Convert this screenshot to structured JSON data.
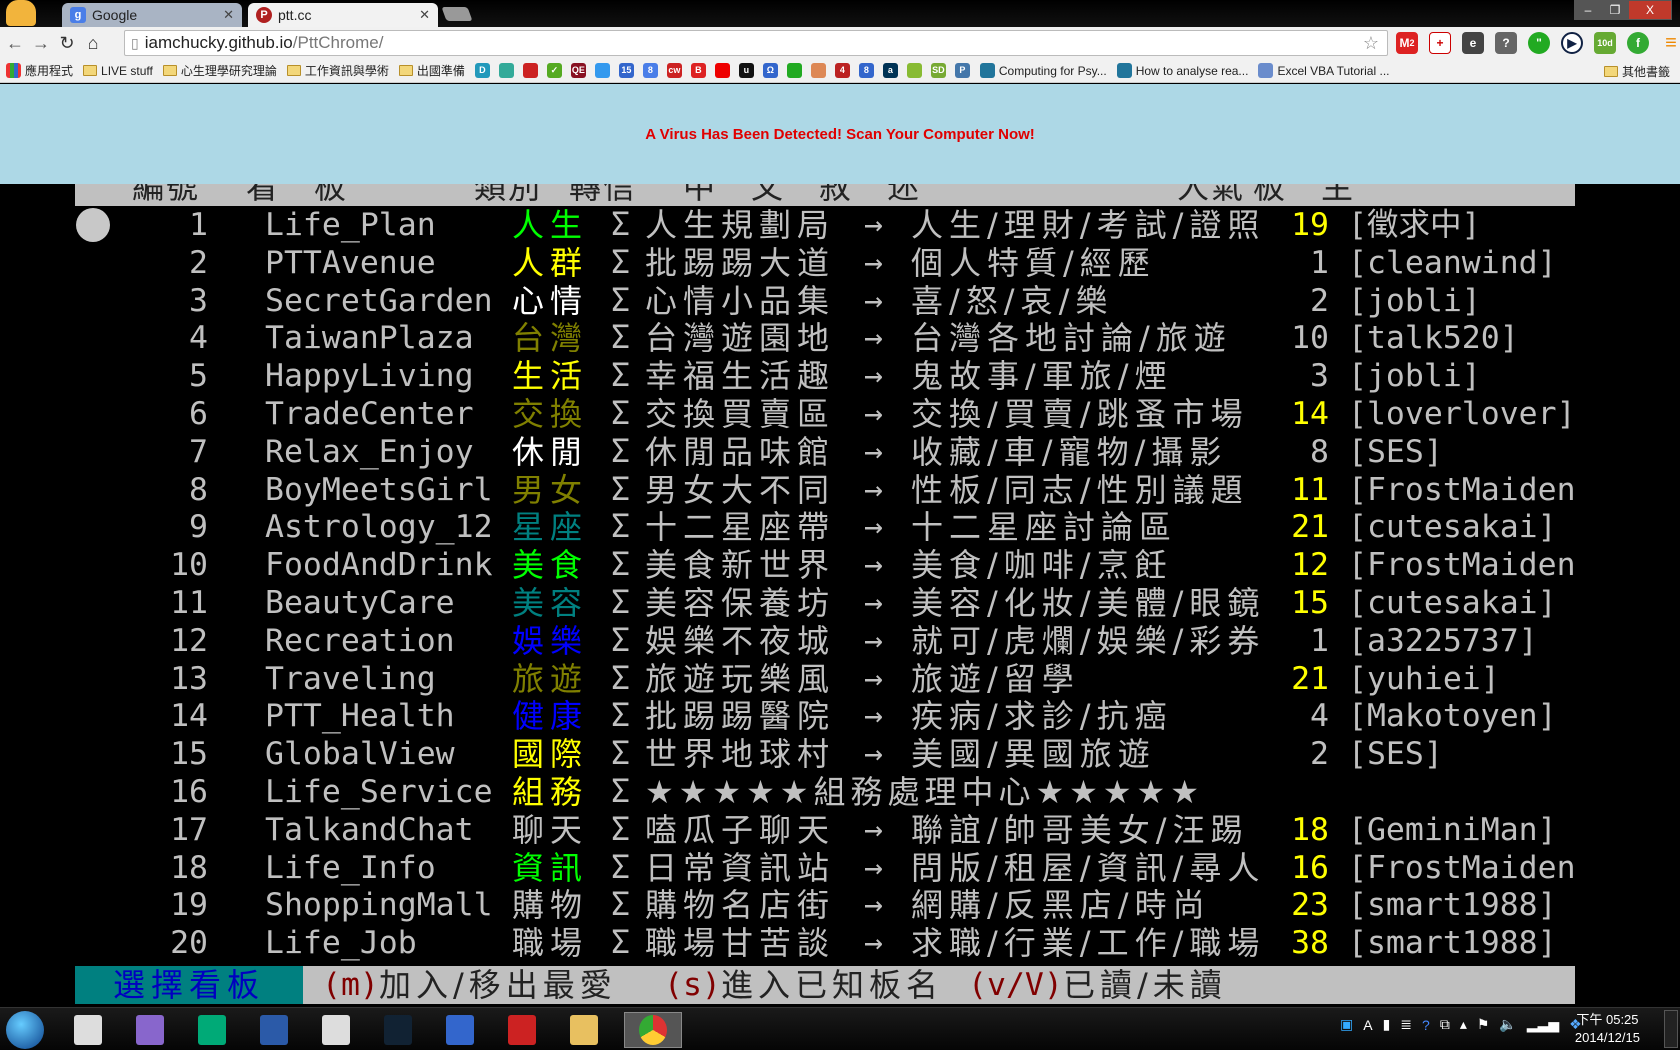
{
  "browser": {
    "tabs": [
      {
        "label": "Google",
        "icon": "google-icon"
      },
      {
        "label": "ptt.cc",
        "icon": "ptt-icon"
      }
    ],
    "url_host": "iamchucky.github.io",
    "url_path": "/PttChrome/",
    "window_controls": {
      "minimize": "–",
      "restore": "❐",
      "close": "X"
    },
    "extension_badges": {
      "gmail": "2",
      "timer": "10d"
    },
    "bookmarks": [
      {
        "label": "應用程式",
        "type": "apps"
      },
      {
        "label": "LIVE stuff",
        "type": "folder"
      },
      {
        "label": "心生理學研究理論",
        "type": "folder"
      },
      {
        "label": "工作資訊與學術",
        "type": "folder"
      },
      {
        "label": "出國準備",
        "type": "folder"
      }
    ],
    "bookmark_icon_labels": [
      "D",
      "",
      "",
      "✓",
      "QE",
      "",
      "15",
      "8",
      "cw",
      "B",
      "",
      "u",
      "Ω",
      "",
      "",
      "4",
      "8",
      "a",
      "",
      "SD",
      "P"
    ],
    "bookmark_links": [
      "Computing for Psy...",
      "How to analyse rea...",
      "Excel VBA Tutorial ..."
    ],
    "other_bookmarks": "其他書籤"
  },
  "ad": {
    "text": "A Virus Has Been Detected! Scan Your Computer Now!"
  },
  "terminal": {
    "header": [
      "編號",
      "看　板",
      "類別",
      "轉信",
      "中　文　敘　述",
      "人氣",
      "板　主"
    ],
    "colors": {
      "green": "#00ff00",
      "yellow": "#ffff00",
      "white": "#ffffff",
      "olive": "#808000",
      "teal": "#008080",
      "blue": "#0000ff",
      "gray": "#c0c0c0"
    },
    "sigma": "Σ",
    "arrow": "→",
    "rows": [
      {
        "num": "1",
        "board": "Life_Plan",
        "cat": "人生",
        "cat_color": "#00ff00",
        "title": "人生規劃局",
        "desc": "人生/理財/考試/證照",
        "pop": "19",
        "pop_color": "#ffff00",
        "mod": "[徵求中]"
      },
      {
        "num": "2",
        "board": "PTTAvenue",
        "cat": "人群",
        "cat_color": "#ffff00",
        "title": "批踢踢大道",
        "desc": "個人特質/經歷",
        "pop": "1",
        "pop_color": "#c0c0c0",
        "mod": "[cleanwind]"
      },
      {
        "num": "3",
        "board": "SecretGarden",
        "cat": "心情",
        "cat_color": "#ffffff",
        "title": "心情小品集",
        "desc": "喜/怒/哀/樂",
        "pop": "2",
        "pop_color": "#c0c0c0",
        "mod": "[jobli]"
      },
      {
        "num": "4",
        "board": "TaiwanPlaza",
        "cat": "台灣",
        "cat_color": "#808000",
        "title": "台灣遊園地",
        "desc": "台灣各地討論/旅遊",
        "pop": "10",
        "pop_color": "#c0c0c0",
        "mod": "[talk520]"
      },
      {
        "num": "5",
        "board": "HappyLiving",
        "cat": "生活",
        "cat_color": "#ffff00",
        "title": "幸福生活趣",
        "desc": "鬼故事/軍旅/煙",
        "pop": "3",
        "pop_color": "#c0c0c0",
        "mod": "[jobli]"
      },
      {
        "num": "6",
        "board": "TradeCenter",
        "cat": "交換",
        "cat_color": "#808000",
        "title": "交換買賣區",
        "desc": "交換/買賣/跳蚤市場",
        "pop": "14",
        "pop_color": "#ffff00",
        "mod": "[loverlover]"
      },
      {
        "num": "7",
        "board": "Relax_Enjoy",
        "cat": "休閒",
        "cat_color": "#ffffff",
        "title": "休閒品味館",
        "desc": "收藏/車/寵物/攝影",
        "pop": "8",
        "pop_color": "#c0c0c0",
        "mod": "[SES]"
      },
      {
        "num": "8",
        "board": "BoyMeetsGirl",
        "cat": "男女",
        "cat_color": "#808000",
        "title": "男女大不同",
        "desc": "性板/同志/性別議題",
        "pop": "11",
        "pop_color": "#ffff00",
        "mod": "[FrostMaiden"
      },
      {
        "num": "9",
        "board": "Astrology_12",
        "cat": "星座",
        "cat_color": "#008080",
        "title": "十二星座帶",
        "desc": "十二星座討論區",
        "pop": "21",
        "pop_color": "#ffff00",
        "mod": "[cutesakai]"
      },
      {
        "num": "10",
        "board": "FoodAndDrink",
        "cat": "美食",
        "cat_color": "#00ff00",
        "title": "美食新世界",
        "desc": "美食/咖啡/烹飪",
        "pop": "12",
        "pop_color": "#ffff00",
        "mod": "[FrostMaiden"
      },
      {
        "num": "11",
        "board": "BeautyCare",
        "cat": "美容",
        "cat_color": "#008080",
        "title": "美容保養坊",
        "desc": "美容/化妝/美體/眼鏡",
        "pop": "15",
        "pop_color": "#ffff00",
        "mod": "[cutesakai]"
      },
      {
        "num": "12",
        "board": "Recreation",
        "cat": "娛樂",
        "cat_color": "#0000ff",
        "title": "娛樂不夜城",
        "desc": "就可/虎爛/娛樂/彩券",
        "pop": "1",
        "pop_color": "#c0c0c0",
        "mod": "[a3225737]"
      },
      {
        "num": "13",
        "board": "Traveling",
        "cat": "旅遊",
        "cat_color": "#808000",
        "title": "旅遊玩樂風",
        "desc": "旅遊/留學",
        "pop": "21",
        "pop_color": "#ffff00",
        "mod": "[yuhiei]"
      },
      {
        "num": "14",
        "board": "PTT_Health",
        "cat": "健康",
        "cat_color": "#0000ff",
        "title": "批踢踢醫院",
        "desc": "疾病/求診/抗癌",
        "pop": "4",
        "pop_color": "#c0c0c0",
        "mod": "[Makotoyen]"
      },
      {
        "num": "15",
        "board": "GlobalView",
        "cat": "國際",
        "cat_color": "#ffff00",
        "title": "世界地球村",
        "desc": "美國/異國旅遊",
        "pop": "2",
        "pop_color": "#c0c0c0",
        "mod": "[SES]"
      },
      {
        "num": "16",
        "board": "Life_Service",
        "cat": "組務",
        "cat_color": "#ffff00",
        "title": "★★★★★組務處理中心★★★★★",
        "no_arrow": true
      },
      {
        "num": "17",
        "board": "TalkandChat",
        "cat": "聊天",
        "cat_color": "#c0c0c0",
        "title": "嗑瓜子聊天",
        "desc": "聯誼/帥哥美女/汪踢",
        "pop": "18",
        "pop_color": "#ffff00",
        "mod": "[GeminiMan]"
      },
      {
        "num": "18",
        "board": "Life_Info",
        "cat": "資訊",
        "cat_color": "#00ff00",
        "title": "日常資訊站",
        "desc": "問版/租屋/資訊/尋人",
        "pop": "16",
        "pop_color": "#ffff00",
        "mod": "[FrostMaiden"
      },
      {
        "num": "19",
        "board": "ShoppingMall",
        "cat": "購物",
        "cat_color": "#c0c0c0",
        "title": "購物名店街",
        "desc": "網購/反黑店/時尚",
        "pop": "23",
        "pop_color": "#ffff00",
        "mod": "[smart1988]"
      },
      {
        "num": "20",
        "board": "Life_Job",
        "cat": "職場",
        "cat_color": "#c0c0c0",
        "title": "職場甘苦談",
        "desc": "求職/行業/工作/職場",
        "pop": "38",
        "pop_color": "#ffff00",
        "mod": "[smart1988]"
      }
    ],
    "status": {
      "mode": "選擇看板",
      "keys": [
        {
          "key": "(m)",
          "label": "加入/移出最愛"
        },
        {
          "key": "(s)",
          "label": "進入已知板名"
        },
        {
          "key": "(v/V)",
          "label": "已讀/未讀"
        }
      ]
    }
  },
  "taskbar": {
    "clock_time": "下午 05:25",
    "clock_date": "2014/12/15"
  }
}
